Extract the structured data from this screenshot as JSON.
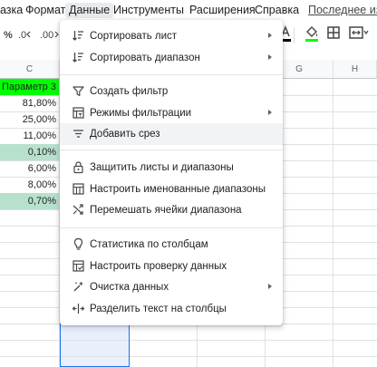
{
  "menubar": {
    "items": [
      "азка",
      "Формат",
      "Данные",
      "Инструменты",
      "Расширения",
      "Справка"
    ],
    "last_edit": "Последнее изм"
  },
  "toolbar": {
    "percent": "%",
    "decrease_decimals": ".0",
    "increase_decimals": ".00",
    "fill_color": "#00ff00"
  },
  "sheet": {
    "columns": [
      "C",
      "G",
      "H"
    ],
    "header_cell": "Параметр 3",
    "values": [
      "81,80%",
      "25,00%",
      "11,00%",
      "0,10%",
      "6,00%",
      "8,00%",
      "0,70%"
    ],
    "highlight_color": "#b7e1cd",
    "header_color": "#00ff00"
  },
  "menu": {
    "items": [
      {
        "label": "Сортировать лист",
        "icon": "sort-icon",
        "submenu": true
      },
      {
        "label": "Сортировать диапазон",
        "icon": "sort-range-icon",
        "submenu": true
      },
      {
        "label": "Создать фильтр",
        "icon": "filter-icon",
        "submenu": false
      },
      {
        "label": "Режимы фильтрации",
        "icon": "filter-views-icon",
        "submenu": true
      },
      {
        "label": "Добавить срез",
        "icon": "slicer-icon",
        "submenu": false
      },
      {
        "label": "Защитить листы и диапазоны",
        "icon": "lock-icon",
        "submenu": false
      },
      {
        "label": "Настроить именованные диапазоны",
        "icon": "named-ranges-icon",
        "submenu": false
      },
      {
        "label": "Перемешать ячейки диапазона",
        "icon": "shuffle-icon",
        "submenu": false
      },
      {
        "label": "Статистика по столбцам",
        "icon": "lightbulb-icon",
        "submenu": false
      },
      {
        "label": "Настроить проверку данных",
        "icon": "data-validation-icon",
        "submenu": false
      },
      {
        "label": "Очистка данных",
        "icon": "data-cleanup-icon",
        "submenu": true
      },
      {
        "label": "Разделить текст на столбцы",
        "icon": "split-text-icon",
        "submenu": false
      }
    ]
  }
}
